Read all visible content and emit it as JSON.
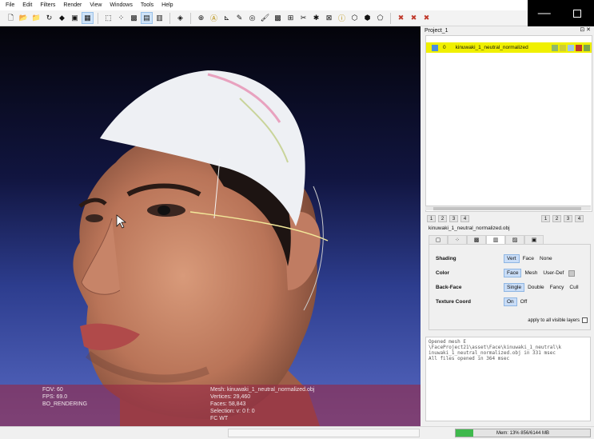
{
  "menu": [
    "File",
    "Edit",
    "Filters",
    "Render",
    "View",
    "Windows",
    "Tools",
    "Help"
  ],
  "window_controls": {
    "minimize": "—"
  },
  "toolbar": [
    {
      "icon": "new-file-icon",
      "glyph": "🗋"
    },
    {
      "icon": "open-folder-icon",
      "glyph": "📂"
    },
    {
      "icon": "import-icon",
      "glyph": "📁"
    },
    {
      "icon": "reload-icon",
      "glyph": "↻"
    },
    {
      "icon": "save-icon",
      "glyph": "◆"
    },
    {
      "icon": "snapshot-icon",
      "glyph": "▣"
    },
    {
      "icon": "view-mode-icon",
      "glyph": "▦",
      "active": true
    },
    {
      "icon": "sep"
    },
    {
      "icon": "bbox-icon",
      "glyph": "⬚"
    },
    {
      "icon": "points-icon",
      "glyph": "⁘"
    },
    {
      "icon": "wireframe-icon",
      "glyph": "▩"
    },
    {
      "icon": "flat-shading-icon",
      "glyph": "▤",
      "active": true
    },
    {
      "icon": "smooth-shading-icon",
      "glyph": "▥"
    },
    {
      "icon": "sep"
    },
    {
      "icon": "layers-icon",
      "glyph": "◈"
    },
    {
      "icon": "sep"
    },
    {
      "icon": "trackball-icon",
      "glyph": "⊕"
    },
    {
      "icon": "annotate-icon",
      "glyph": "Ⓐ"
    },
    {
      "icon": "measure-icon",
      "glyph": "⊾"
    },
    {
      "icon": "paint-icon",
      "glyph": "✎"
    },
    {
      "icon": "select-icon",
      "glyph": "◎"
    },
    {
      "icon": "brush-icon",
      "glyph": "🖌"
    },
    {
      "icon": "color-tool-icon",
      "glyph": "▩"
    },
    {
      "icon": "align-icon",
      "glyph": "⊞"
    },
    {
      "icon": "edit-mesh-icon",
      "glyph": "✂"
    },
    {
      "icon": "vertex-select-icon",
      "glyph": "✱"
    },
    {
      "icon": "face-select-icon",
      "glyph": "⊠"
    },
    {
      "icon": "info-icon",
      "glyph": "ⓘ"
    },
    {
      "icon": "select-faces-icon",
      "glyph": "⬡"
    },
    {
      "icon": "select-connected-icon",
      "glyph": "⬢"
    },
    {
      "icon": "select-vertices-icon",
      "glyph": "⬠"
    },
    {
      "icon": "sep"
    },
    {
      "icon": "delete-faces-icon",
      "glyph": "✖"
    },
    {
      "icon": "delete-vertices-icon",
      "glyph": "✖"
    },
    {
      "icon": "delete-all-icon",
      "glyph": "✖"
    }
  ],
  "viewport": {
    "info_left": [
      "FOV: 60",
      "FPS:   69.0",
      "BO_RENDERING"
    ],
    "info_right": [
      "Mesh: kinuwaki_1_neutral_normalized.obj",
      "Vertices: 29,460",
      "Faces: 58,843",
      "Selection: v: 0 f: 0",
      "FC WT"
    ]
  },
  "panel": {
    "title": "Project_1",
    "title_controls": "⊡ ✕",
    "layer": {
      "id": "0",
      "name": "kinuwaki_1_neutral_normalized"
    },
    "num_left": [
      "1",
      "2",
      "3",
      "4"
    ],
    "num_right": [
      "1",
      "2",
      "3",
      "4"
    ],
    "mesh_name": "kinuwaki_1_neutral_normalized.obj",
    "tabs": [
      "▢",
      "⁘",
      "▩",
      "▥",
      "▨",
      "▣"
    ],
    "shading": {
      "label": "Shading",
      "options": [
        "Vert",
        "Face",
        "None"
      ]
    },
    "color": {
      "label": "Color",
      "options": [
        "Face",
        "Mesh",
        "User-Def"
      ]
    },
    "backface": {
      "label": "Back-Face",
      "options": [
        "Single",
        "Double",
        "Fancy",
        "Cull"
      ]
    },
    "texture": {
      "label": "Texture Coord",
      "options": [
        "On",
        "Off"
      ]
    },
    "apply_all": "apply to all visible layers",
    "log": [
      "Opened mesh E",
      "\\FaceProject21\\asset\\Face\\kinuwaki_1_neutral\\k",
      "inuwaki_1_neutral_normalized.obj in 331 msec",
      "All files opened in 364 msec"
    ]
  },
  "status": {
    "memory": "Mem: 13% 856/6144 MB",
    "memory_fraction": 0.13
  },
  "colors": {
    "accent": "#4b8ede",
    "layer_highlight": "#f0f000",
    "info_overlay": "#962846",
    "memory_bar": "#3fb94d"
  }
}
